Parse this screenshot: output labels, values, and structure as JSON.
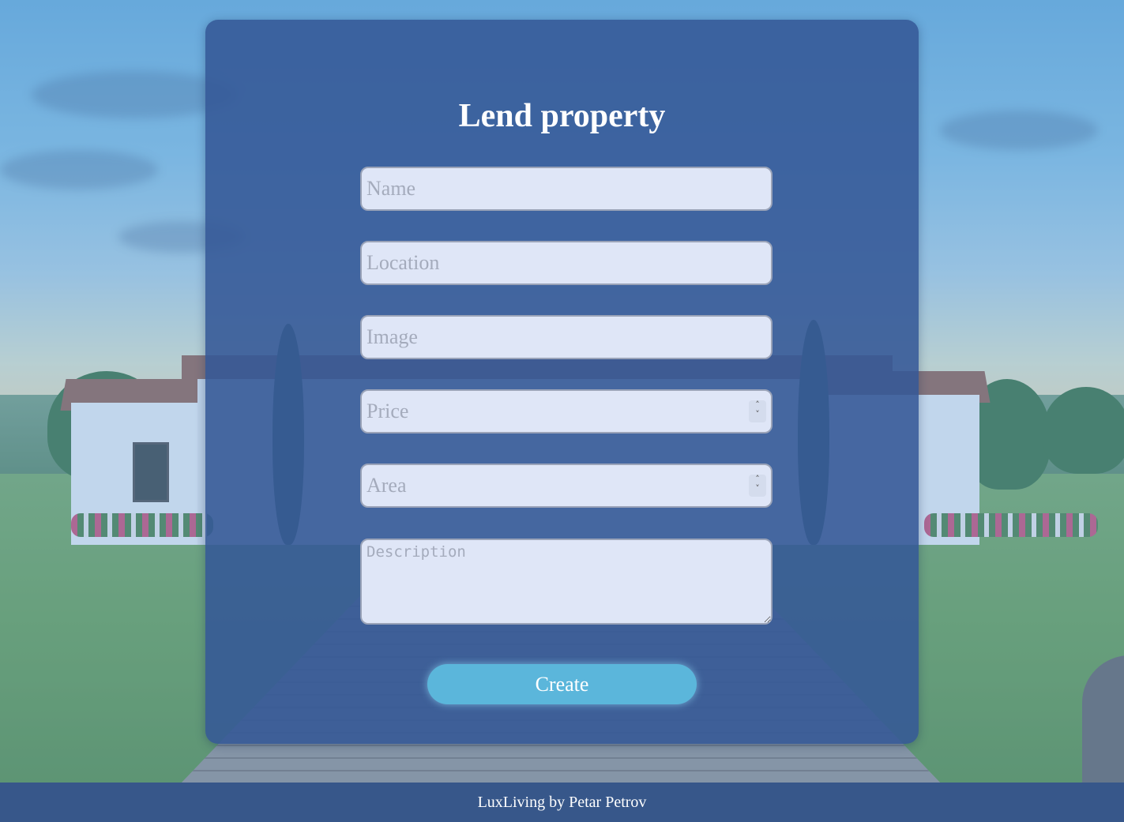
{
  "form": {
    "title": "Lend property",
    "fields": {
      "name": {
        "placeholder": "Name",
        "value": ""
      },
      "location": {
        "placeholder": "Location",
        "value": ""
      },
      "image": {
        "placeholder": "Image",
        "value": ""
      },
      "price": {
        "placeholder": "Price",
        "value": ""
      },
      "area": {
        "placeholder": "Area",
        "value": ""
      },
      "description": {
        "placeholder": "Description",
        "value": ""
      }
    },
    "submit_label": "Create"
  },
  "footer": {
    "text": "LuxLiving by Petar Petrov"
  },
  "colors": {
    "panel": "#345896",
    "input_bg": "#dfe6f7",
    "button": "#5bb6db",
    "footer": "#37578a"
  },
  "icons": [
    "spinner-up-down-icon"
  ]
}
